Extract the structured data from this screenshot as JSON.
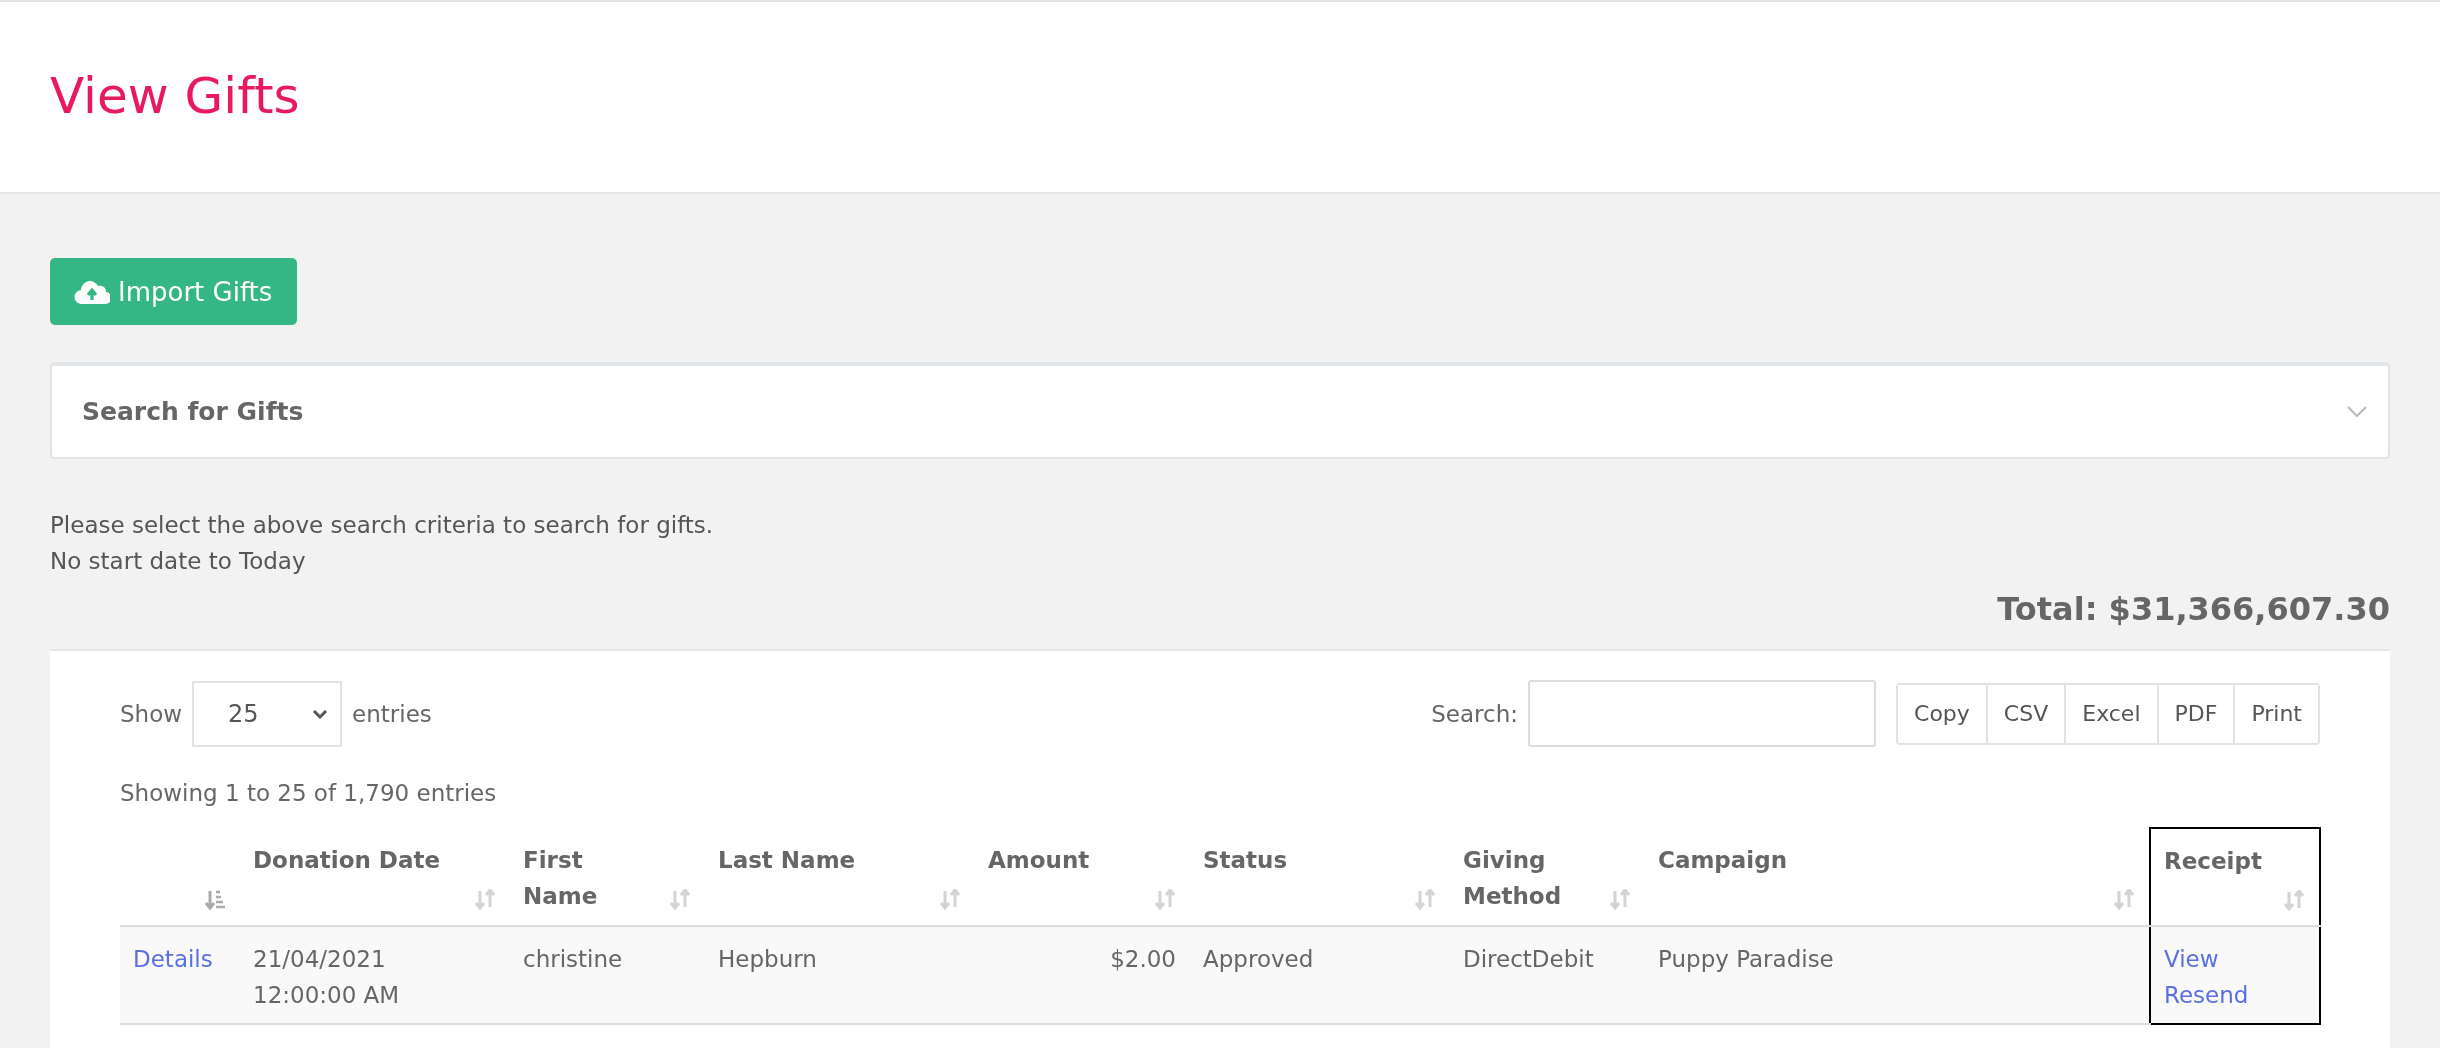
{
  "page": {
    "title": "View Gifts"
  },
  "import_button": {
    "label": "Import Gifts"
  },
  "search_panel": {
    "title": "Search for Gifts",
    "expanded": false
  },
  "notes": [
    "Please select the above search criteria to search for gifts.",
    "No start date to Today"
  ],
  "total": "Total: $31,366,607.30",
  "table": {
    "length_menu": {
      "before": "Show",
      "value": "25",
      "after": "entries"
    },
    "search": {
      "label": "Search:"
    },
    "export_buttons": [
      "Copy",
      "CSV",
      "Excel",
      "PDF",
      "Print"
    ],
    "info": "Showing 1 to 25 of 1,790 entries",
    "columns": [
      {
        "sorted": true,
        "highlighted": false
      },
      {
        "label": "Donation Date",
        "sorted": false,
        "highlighted": false
      },
      {
        "label": "First Name",
        "sorted": false,
        "highlighted": false
      },
      {
        "label": "Last Name",
        "sorted": false,
        "highlighted": false
      },
      {
        "label": "Amount",
        "sorted": false,
        "highlighted": false
      },
      {
        "label": "Status",
        "sorted": false,
        "highlighted": false
      },
      {
        "label": "Giving Method",
        "sorted": false,
        "highlighted": false
      },
      {
        "label": "Campaign",
        "sorted": false,
        "highlighted": false
      },
      {
        "label": "Receipt",
        "sorted": false,
        "highlighted": true
      }
    ],
    "rows": [
      {
        "cells": [
          {
            "kind": "links",
            "links": [
              "Details"
            ]
          },
          {
            "kind": "text",
            "text": "21/04/2021 12:00:00 AM"
          },
          {
            "kind": "text",
            "text": "christine"
          },
          {
            "kind": "text",
            "text": "Hepburn"
          },
          {
            "kind": "number",
            "text": "$2.00"
          },
          {
            "kind": "text",
            "text": "Approved"
          },
          {
            "kind": "text",
            "text": "DirectDebit"
          },
          {
            "kind": "text",
            "text": "Puppy Paradise"
          },
          {
            "kind": "links",
            "links": [
              "View",
              "Resend"
            ]
          }
        ]
      }
    ]
  }
}
